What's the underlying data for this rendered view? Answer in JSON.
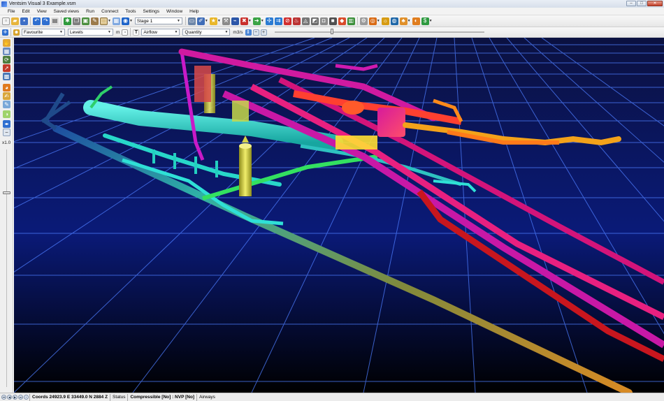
{
  "window": {
    "title": "Ventsim Visual 3   Example.vsm",
    "minimize_label": "–",
    "maximize_label": "□",
    "close_label": "✕"
  },
  "menu": [
    "File",
    "Edit",
    "View",
    "Saved views",
    "Run",
    "Connect",
    "Tools",
    "Settings",
    "Window",
    "Help"
  ],
  "toolbar1": {
    "stage_select": "Stage 1"
  },
  "toolbar2": {
    "favourite_select": "Favourite",
    "levels_select": "Levels",
    "levels_unit": "m",
    "airflow_select": "Airflow",
    "quantity_select": "Quantity",
    "quantity_unit": "m3/s",
    "slider_level": 0.27
  },
  "leftstrip": {
    "zoom_label": "x1.0",
    "slider_level": 0.18
  },
  "status": {
    "coords": "Coords 24923.9 E    33449.0 N    2884 Z",
    "status_label": "Status",
    "compressible": "Compressible [No] : NVP [No]",
    "airways": "Airways"
  },
  "colors": {
    "accent": "#2a5cc8",
    "background_top": "#0b1140",
    "background_bottom": "#000000",
    "grid_line": "#4d7dff"
  }
}
